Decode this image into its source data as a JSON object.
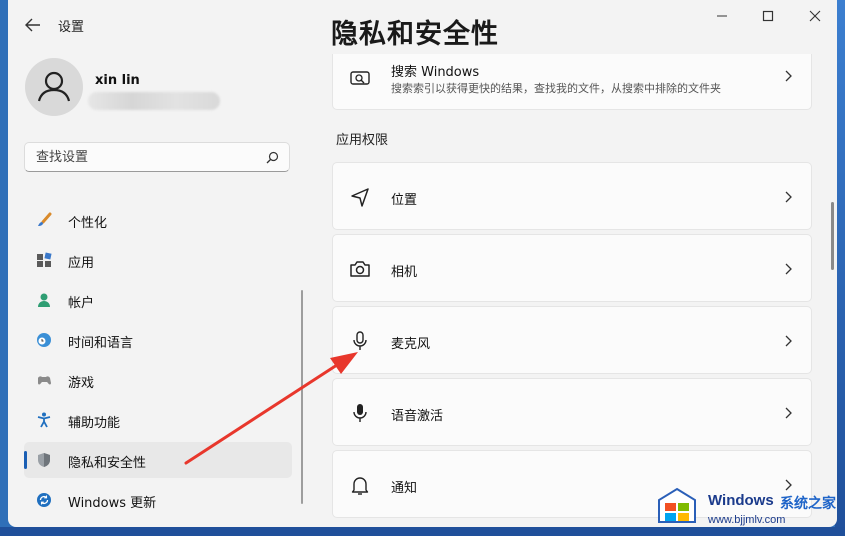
{
  "window": {
    "app_title": "设置",
    "page_title": "隐私和安全性"
  },
  "account": {
    "name": "xin lin"
  },
  "search": {
    "placeholder": "查找设置"
  },
  "sidebar": {
    "items": [
      {
        "label": "个性化",
        "icon": "paintbrush-icon"
      },
      {
        "label": "应用",
        "icon": "apps-icon"
      },
      {
        "label": "帐户",
        "icon": "account-icon"
      },
      {
        "label": "时间和语言",
        "icon": "globe-clock-icon"
      },
      {
        "label": "游戏",
        "icon": "gamepad-icon"
      },
      {
        "label": "辅助功能",
        "icon": "accessibility-icon"
      },
      {
        "label": "隐私和安全性",
        "icon": "shield-icon",
        "selected": true
      },
      {
        "label": "Windows 更新",
        "icon": "update-icon"
      }
    ]
  },
  "main": {
    "search_windows": {
      "title": "搜索 Windows",
      "subtitle": "搜索索引以获得更快的结果，查找我的文件，从搜索中排除的文件夹"
    },
    "section_label": "应用权限",
    "permissions": [
      {
        "label": "位置",
        "icon": "location-icon"
      },
      {
        "label": "相机",
        "icon": "camera-icon"
      },
      {
        "label": "麦克风",
        "icon": "microphone-icon"
      },
      {
        "label": "语音激活",
        "icon": "voice-activation-icon"
      },
      {
        "label": "通知",
        "icon": "bell-icon"
      }
    ]
  },
  "watermark": {
    "title": "Windows",
    "title2": "系统之家",
    "url": "www.bjjmlv.com"
  },
  "colors": {
    "accent": "#1a5fb4",
    "annotation_arrow": "#e8372c"
  }
}
